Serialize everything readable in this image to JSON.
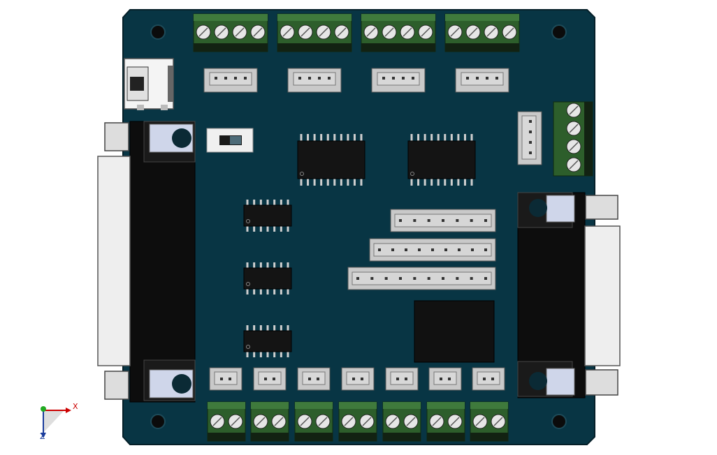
{
  "app": {
    "view": "cad-3d-viewport"
  },
  "colors": {
    "pcb": "#083544",
    "pcb_edge": "#051f28",
    "terminal_green": "#2d5e2b",
    "terminal_dark": "#122212",
    "screw": "#e6e6e6",
    "header_gray": "#c9c9c9",
    "ic_black": "#141414",
    "connector_beige": "#eeeeee"
  },
  "triad": {
    "x_label": "X",
    "z_label": "Z"
  },
  "model": {
    "top_terminal_blocks": 4,
    "bottom_terminal_blocks": 7,
    "right_terminal_block_screws": 4,
    "top_headers_4pin": 4,
    "bottom_headers_2pin": 7,
    "soic_large": 2,
    "soic_small": 3,
    "ribbon_headers": [
      7,
      9,
      10
    ],
    "mounting_holes": 4,
    "db_connectors": 2
  }
}
